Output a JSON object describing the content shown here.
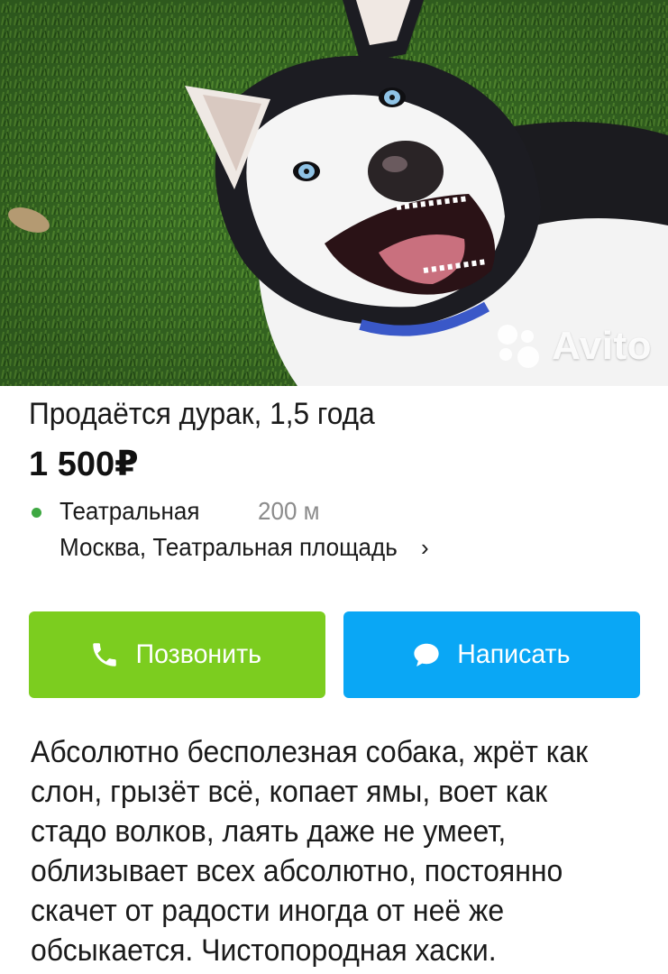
{
  "listing": {
    "title": "Продаётся дурак, 1,5 года",
    "price": "1 500₽",
    "location": {
      "metro": "Театральная",
      "distance": "200 м",
      "address": "Москва, Театральная площадь",
      "metro_color": "#3ea842"
    },
    "description": "Абсолютно бесполезная собака, жрёт как слон, грызёт всё, копает ямы, воет как стадо волков, лаять даже не умеет, облизывает всех абсолютно, постоянно скачет от радости иногда от неё же обсыкается. Чистопородная хаски."
  },
  "photo": {
    "watermark": "Avito"
  },
  "actions": {
    "call_label": "Позвонить",
    "write_label": "Написать",
    "call_color": "#7ccd1f",
    "write_color": "#0aa7f5"
  },
  "icons": {
    "phone": "phone-icon",
    "chat": "chat-bubble-icon",
    "chevron": "chevron-right-icon",
    "metro": "metro-dot-icon"
  }
}
